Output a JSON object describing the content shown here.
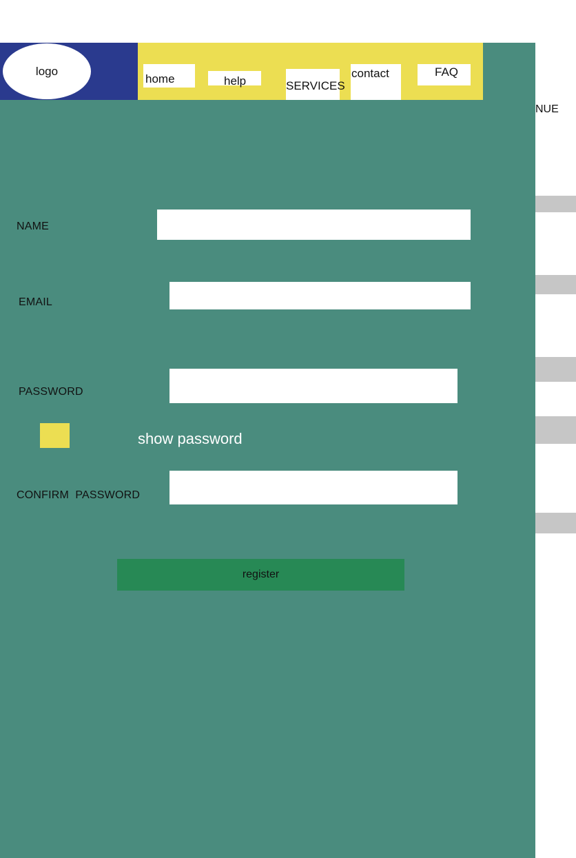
{
  "header": {
    "logo_text": "logo",
    "nav": {
      "home": "home",
      "help": "help",
      "services": "SERVICES",
      "contact": "contact",
      "faq": "FAQ"
    }
  },
  "side": {
    "overflow_text": "NUE"
  },
  "form": {
    "name_label": "NAME",
    "name_value": "",
    "email_label": "EMAIL",
    "email_value": "",
    "password_label": "PASSWORD",
    "password_value": "",
    "show_password_label": "show password",
    "show_password_checked": false,
    "confirm_label": "CONFIRM  PASSWORD",
    "confirm_value": "",
    "register_label": "register"
  },
  "colors": {
    "panel": "#4a8c7e",
    "logo_area": "#2a3a8e",
    "nav_area": "#ecde52",
    "checkbox": "#ecde52",
    "register_button": "#278955",
    "side_bars": "#c6c6c6"
  }
}
